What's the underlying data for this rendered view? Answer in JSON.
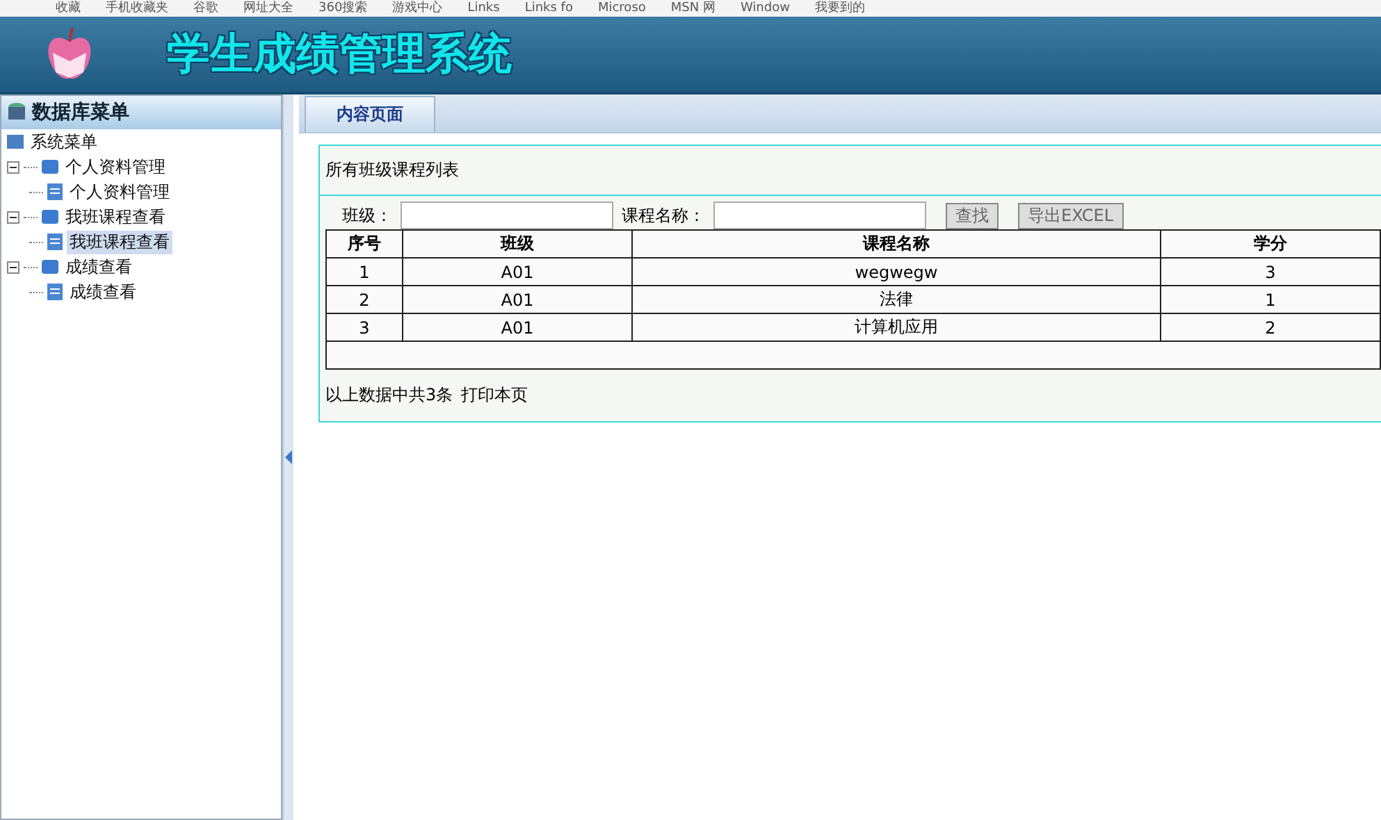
{
  "bookmarks": [
    {
      "label": "收藏"
    },
    {
      "label": "手机收藏夹"
    },
    {
      "label": "谷歌"
    },
    {
      "label": "网址大全"
    },
    {
      "label": "360搜索"
    },
    {
      "label": "游戏中心"
    },
    {
      "label": "Links"
    },
    {
      "label": "Links fo"
    },
    {
      "label": "Microso"
    },
    {
      "label": "MSN 网"
    },
    {
      "label": "Window"
    },
    {
      "label": "我要到的"
    }
  ],
  "header": {
    "title": "学生成绩管理系统"
  },
  "sidebar": {
    "title": "数据库菜单",
    "root": "系统菜单",
    "items": [
      {
        "label": "个人资料管理",
        "expanded": true,
        "children": [
          {
            "label": "个人资料管理",
            "selected": false
          }
        ]
      },
      {
        "label": "我班课程查看",
        "expanded": true,
        "children": [
          {
            "label": "我班课程查看",
            "selected": true
          }
        ]
      },
      {
        "label": "成绩查看",
        "expanded": true,
        "children": [
          {
            "label": "成绩查看",
            "selected": false
          }
        ]
      }
    ]
  },
  "tabs": [
    {
      "label": "内容页面",
      "selected": true
    }
  ],
  "panel": {
    "title": "所有班级课程列表",
    "filters": [
      {
        "label": "班级："
      },
      {
        "label": "课程名称："
      }
    ],
    "buttons": [
      "查找",
      "导出EXCEL"
    ],
    "table": {
      "columns": [
        "序号",
        "班级",
        "课程名称",
        "学分"
      ],
      "rows": [
        [
          "1",
          "A01",
          "wegwegw",
          "3"
        ],
        [
          "2",
          "A01",
          "法律",
          "1"
        ],
        [
          "3",
          "A01",
          "计算机应用",
          "2"
        ]
      ]
    },
    "footer": {
      "summary": "以上数据中共3条",
      "print_link": "打印本页"
    }
  }
}
